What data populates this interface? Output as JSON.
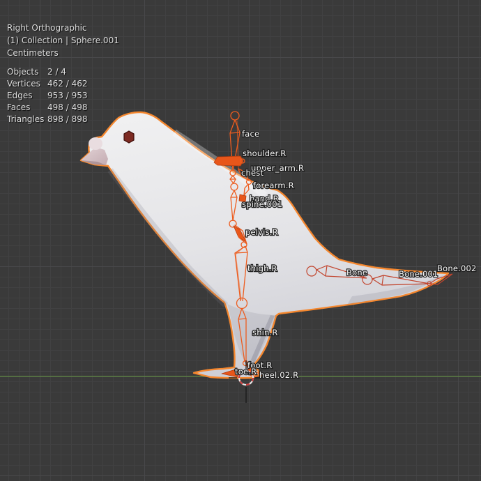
{
  "header": {
    "view_name": "Right Orthographic",
    "collection_info": "(1) Collection | Sphere.001",
    "units": "Centimeters"
  },
  "stats": {
    "rows": [
      {
        "label": "Objects",
        "value": "2 / 4"
      },
      {
        "label": "Vertices",
        "value": "462 / 462"
      },
      {
        "label": "Edges",
        "value": "953 / 953"
      },
      {
        "label": "Faces",
        "value": "498 / 498"
      },
      {
        "label": "Triangles",
        "value": "898 / 898"
      }
    ]
  },
  "bones": [
    {
      "id": "face",
      "label": "face"
    },
    {
      "id": "shoulder-r",
      "label": "shoulder.R"
    },
    {
      "id": "upper-arm-r",
      "label": "upper_arm.R"
    },
    {
      "id": "chest",
      "label": "chest"
    },
    {
      "id": "forearm-r",
      "label": "forearm.R"
    },
    {
      "id": "hand-r",
      "label": "hand.R"
    },
    {
      "id": "spine-001",
      "label": "spine.001"
    },
    {
      "id": "pelvis-r",
      "label": "pelvis.R"
    },
    {
      "id": "thigh-r",
      "label": "thigh.R"
    },
    {
      "id": "bone",
      "label": "Bone"
    },
    {
      "id": "bone-001",
      "label": "Bone.001"
    },
    {
      "id": "bone-002",
      "label": "Bone.002"
    },
    {
      "id": "shin-r",
      "label": "shin.R"
    },
    {
      "id": "foot-r",
      "label": "foot.R"
    },
    {
      "id": "toe-r",
      "label": "toe.R"
    },
    {
      "id": "heel-02-r",
      "label": "heel.02.R"
    }
  ],
  "colors": {
    "background": "#3a3a3a",
    "grid_fine": "#414142",
    "grid_major": "#48484a",
    "axis_y_green": "#5d7f45",
    "selection_outline": "#f5872e",
    "bone_selected": "#ed5c1e",
    "bone_unselected": "#c2452e",
    "cursor_red": "#cc3b3b",
    "eye": "#7c2a22",
    "body": "#e9e9ec"
  }
}
